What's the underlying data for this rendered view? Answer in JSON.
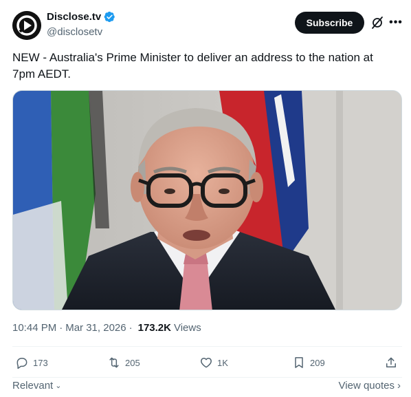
{
  "author": {
    "display_name": "Disclose.tv",
    "handle": "@disclosetv",
    "avatar_icon": "disclose-tv-logo",
    "verified_color": "#1d9bf0"
  },
  "header": {
    "subscribe_label": "Subscribe",
    "grok_icon": "grok-icon",
    "more_icon": "more-dots-icon"
  },
  "tweet": {
    "text": "NEW - Australia's Prime Minister to deliver an address to the nation at 7pm AEDT."
  },
  "meta": {
    "time": "10:44 PM",
    "separator": "·",
    "date": "Mar 31, 2026",
    "views_count": "173.2K",
    "views_label": "Views"
  },
  "actions": {
    "replies": "173",
    "reposts": "205",
    "likes": "1K",
    "bookmarks": "209"
  },
  "footer": {
    "sort_label": "Relevant",
    "view_quotes_label": "View quotes"
  },
  "colors": {
    "text_primary": "#0f1419",
    "text_secondary": "#536471",
    "accent": "#1d9bf0",
    "subscribe_bg": "#0f1419"
  }
}
